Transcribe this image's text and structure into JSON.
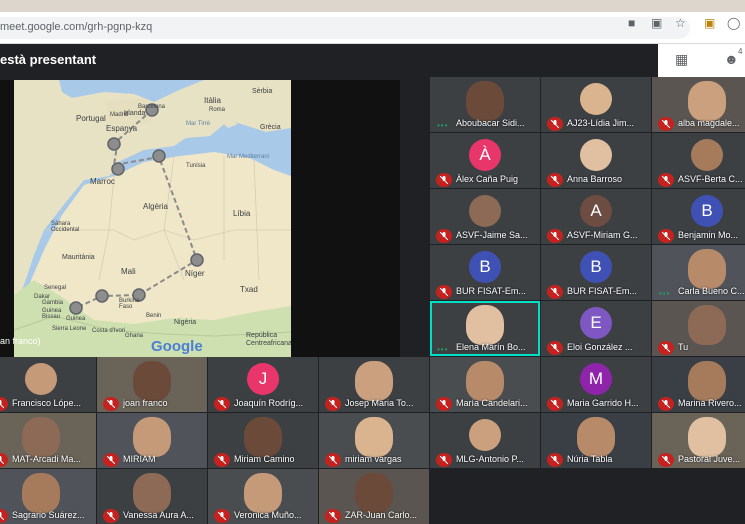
{
  "browser": {
    "url": "meet.google.com/grh-pgnp-kzq",
    "icons": [
      "camera-icon",
      "translate-icon",
      "star-icon",
      "extension-icon",
      "profile-icon"
    ]
  },
  "meet": {
    "presenting_text": "està presentant",
    "presenter_name": "an franco)",
    "top_panel": {
      "grid_icon": "grid-icon",
      "people_icon": "people-icon",
      "people_count": "4"
    },
    "map": {
      "labels": [
        "Irlanda",
        "Portugal",
        "Espanya",
        "Madrid",
        "Barcelona",
        "Itàlia",
        "Roma",
        "Sèrbia",
        "Grècia",
        "Mar Tirrè",
        "Mar Mediterrani",
        "Tunísia",
        "Marroc",
        "Algèria",
        "Líbia",
        "Sàhara Occidental",
        "Mauritània",
        "Mali",
        "Níger",
        "Txad",
        "Senegal",
        "Dakar",
        "Gàmbia",
        "Guinea Bissau",
        "Guinea",
        "Sierra Leone",
        "Burkina Faso",
        "Costa d'Ivori",
        "Benin",
        "Nigèria",
        "República Centreafricana",
        "Ghana",
        "Google"
      ],
      "route_stops": 8
    },
    "participants": [
      {
        "name": "Aboubacar Sidi...",
        "mic": "active"
      },
      {
        "name": "AJ23-Lídia Jim...",
        "mic": "muted"
      },
      {
        "name": "alba magdale...",
        "mic": "muted"
      },
      {
        "name": "Àlex Caña Puig",
        "mic": "muted",
        "initial": "À"
      },
      {
        "name": "Anna Barroso",
        "mic": "muted"
      },
      {
        "name": "ASVF-Berta C...",
        "mic": "muted"
      },
      {
        "name": "ASVF-Jaime Sa...",
        "mic": "muted"
      },
      {
        "name": "ASVF-Miriam G...",
        "mic": "muted",
        "initial": "A"
      },
      {
        "name": "Benjamin Mo...",
        "mic": "muted",
        "initial": "B"
      },
      {
        "name": "BUR FISAT-Em...",
        "mic": "muted",
        "initial": "B"
      },
      {
        "name": "BUR FISAT-Em...",
        "mic": "muted",
        "initial": "B"
      },
      {
        "name": "Carla Bueno C...",
        "mic": "active"
      },
      {
        "name": "Elena Marín Bo...",
        "mic": "speaking"
      },
      {
        "name": "Eloi González ...",
        "mic": "muted",
        "initial": "E"
      },
      {
        "name": "Tu",
        "mic": "muted"
      },
      {
        "name": "Francisco Lópe...",
        "mic": "muted"
      },
      {
        "name": "joan franco",
        "mic": "muted"
      },
      {
        "name": "Joaquín Rodríg...",
        "mic": "muted",
        "initial": "J"
      },
      {
        "name": "Josep Maria To...",
        "mic": "muted"
      },
      {
        "name": "María Candelari...",
        "mic": "muted"
      },
      {
        "name": "Maria Garrido H...",
        "mic": "muted",
        "initial": "M"
      },
      {
        "name": "Marina Rivero...",
        "mic": "muted"
      },
      {
        "name": "MAT-Arcadi Ma...",
        "mic": "muted"
      },
      {
        "name": "MIRIAM",
        "mic": "muted"
      },
      {
        "name": "Miriam Camino",
        "mic": "muted"
      },
      {
        "name": "miriam vargas",
        "mic": "muted"
      },
      {
        "name": "MLG-Antonio P...",
        "mic": "muted"
      },
      {
        "name": "Núria Tabla",
        "mic": "muted"
      },
      {
        "name": "Pastoral Juve...",
        "mic": "muted"
      },
      {
        "name": "Sagrario Suárez...",
        "mic": "muted"
      },
      {
        "name": "Vanessa Aura A...",
        "mic": "muted"
      },
      {
        "name": "Veronica Muño...",
        "mic": "muted"
      },
      {
        "name": "ZAR-Juan Carlo...",
        "mic": "muted"
      }
    ]
  }
}
